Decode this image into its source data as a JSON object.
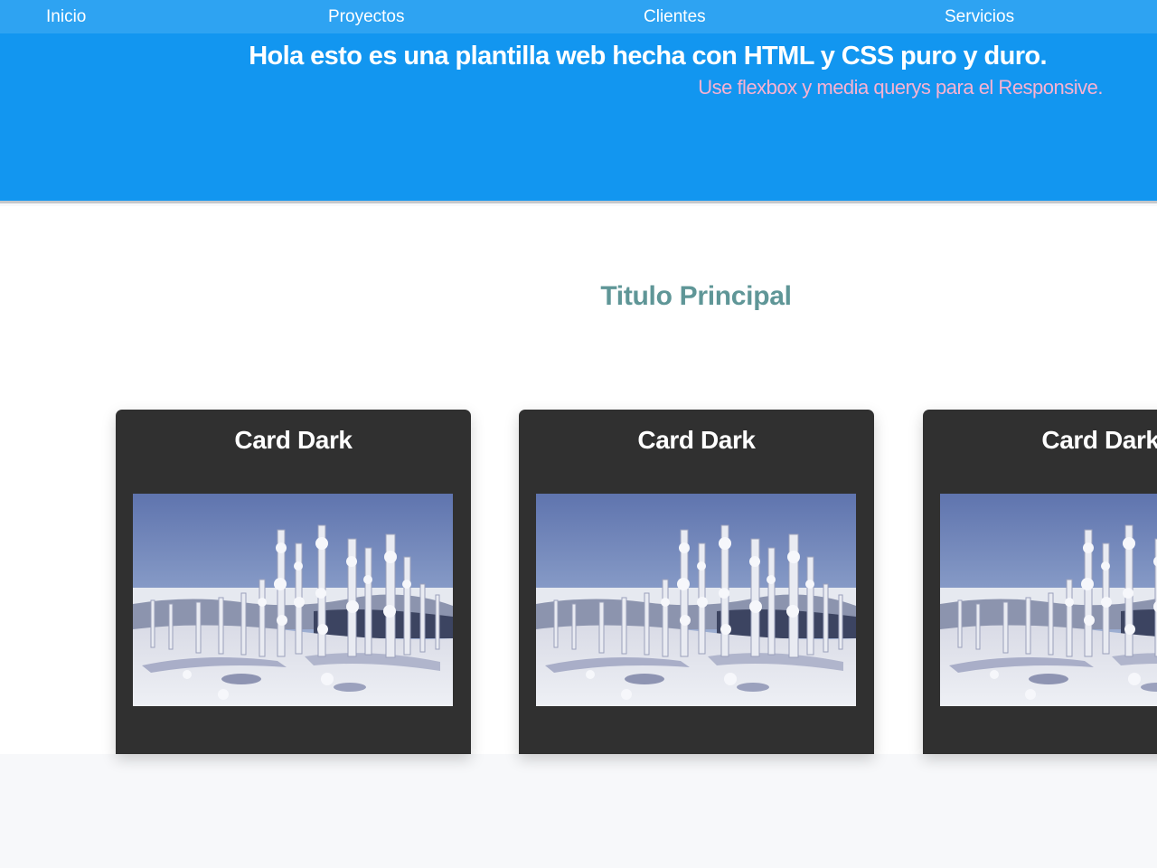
{
  "nav": {
    "items": [
      {
        "label": "Inicio"
      },
      {
        "label": "Proyectos"
      },
      {
        "label": "Clientes"
      },
      {
        "label": "Servicios"
      }
    ]
  },
  "hero": {
    "title": "Hola esto es una plantilla web hecha con HTML y CSS puro y duro.",
    "subtitle": "Use flexbox y media querys para el Responsive."
  },
  "main": {
    "title": "Titulo Principal"
  },
  "cards": [
    {
      "title": "Card Dark",
      "image_icon": "snowy-forest-image"
    },
    {
      "title": "Card Dark",
      "image_icon": "snowy-forest-image"
    },
    {
      "title": "Card Dark",
      "image_icon": "snowy-forest-image"
    }
  ],
  "colors": {
    "header_bg": "#1296f0",
    "navbar_bg": "#2ea3f2",
    "subtitle": "#f8b2d2",
    "main_title": "#5f9697",
    "card_bg": "#303030",
    "page_bg": "#f7f8fa"
  }
}
